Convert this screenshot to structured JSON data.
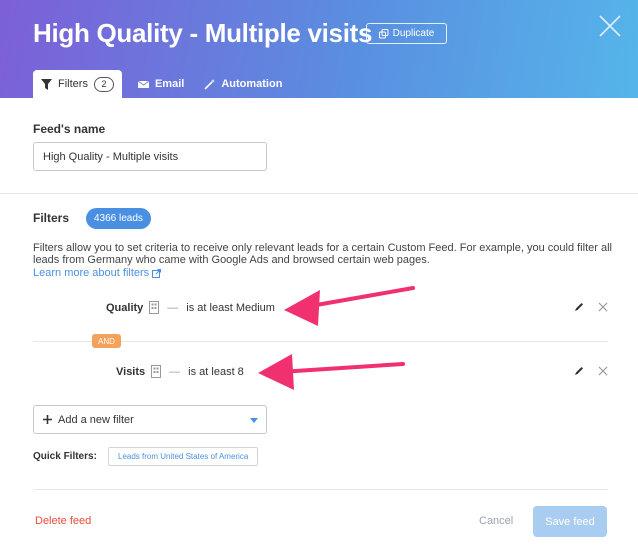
{
  "modal": {
    "title": "High Quality - Multiple visits",
    "duplicate_label": "Duplicate"
  },
  "tabs": [
    {
      "label": "Filters",
      "count": "2",
      "icon": "filter-icon"
    },
    {
      "label": "Email",
      "icon": "email-icon"
    },
    {
      "label": "Automation",
      "icon": "magic-wand-icon"
    }
  ],
  "feed_name": {
    "label": "Feed's name",
    "value": "High Quality - Multiple visits"
  },
  "filters": {
    "title": "Filters",
    "leads_badge": "4366 leads",
    "description": "Filters allow you to set criteria to receive only relevant leads for a certain Custom Feed. For example, you could filter all leads from Germany who came with Google Ads and browsed certain web pages.",
    "learn_more": "Learn more about filters",
    "rows": [
      {
        "name": "Quality",
        "dash": "—",
        "condition": "is at least Medium"
      },
      {
        "name": "Visits",
        "dash": "—",
        "condition": "is at least 8"
      }
    ],
    "and_label": "AND",
    "add_filter": "Add a new filter",
    "quick_filters_label": "Quick Filters:",
    "quick_filters": [
      "Leads from United States of America"
    ]
  },
  "footer": {
    "delete": "Delete feed",
    "cancel": "Cancel",
    "save": "Save feed"
  },
  "colors": {
    "accent": "#4a90e2",
    "and_badge": "#f4a259",
    "delete": "#e74c3c",
    "arrow": "#f0306f"
  }
}
